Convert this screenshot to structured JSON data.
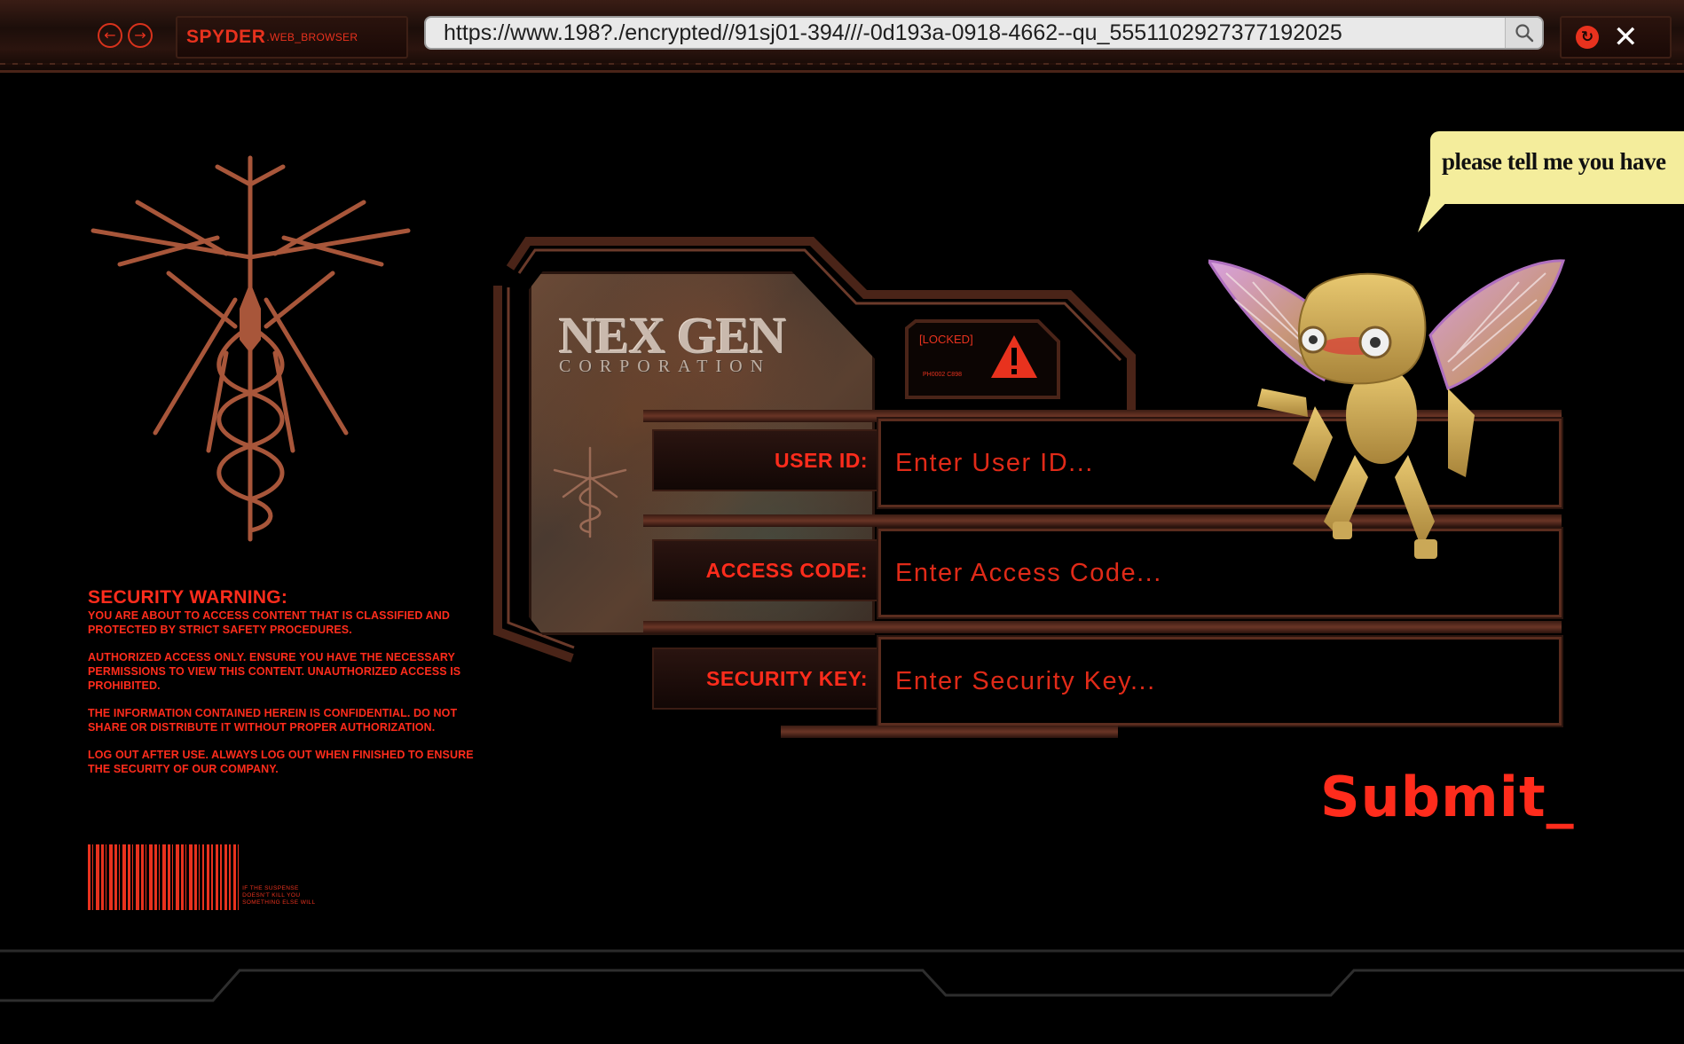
{
  "browser": {
    "name_main": "SPYDER",
    "name_sub": ".WEB_BROWSER",
    "url": "https://www.198?./encrypted//91sj01-394///-0d193a-0918-4662--qu_5551102927377192025",
    "back_icon": "arrow-left-circle-icon",
    "forward_icon": "arrow-right-circle-icon",
    "search_icon": "magnifier-icon",
    "close_glyph": "✕"
  },
  "logo": {
    "name": "NEX GEN",
    "sub": "CORPORATION"
  },
  "status": {
    "locked_label": "[LOCKED]",
    "locked_code": "PH0002 C898"
  },
  "form": {
    "user_id_label": "USER ID:",
    "user_id_placeholder": "Enter User ID...",
    "access_code_label": "ACCESS CODE:",
    "access_code_placeholder": "Enter Access Code...",
    "security_key_label": "SECURITY KEY:",
    "security_key_placeholder": "Enter Security Key...",
    "submit_label": "Submit_"
  },
  "warning": {
    "title": "SECURITY WARNING:",
    "p1": "YOU ARE ABOUT TO ACCESS CONTENT THAT IS CLASSIFIED AND PROTECTED BY STRICT SAFETY PROCEDURES.",
    "p2": "AUTHORIZED ACCESS ONLY. ENSURE YOU HAVE THE NECESSARY PERMISSIONS TO VIEW THIS CONTENT. UNAUTHORIZED ACCESS IS PROHIBITED.",
    "p3": "THE INFORMATION CONTAINED HEREIN IS CONFIDENTIAL. DO NOT SHARE OR DISTRIBUTE IT WITHOUT PROPER AUTHORIZATION.",
    "p4": "LOG OUT AFTER USE. ALWAYS LOG OUT WHEN FINISHED TO ENSURE THE SECURITY OF OUR COMPANY."
  },
  "barcode": {
    "text": "IF THE SUSPENSE DOESN'T KILL YOU SOMETHING ELSE WILL"
  },
  "mascot": {
    "speech": "please tell me you have"
  },
  "colors": {
    "accent": "#e8321e",
    "background": "#000000",
    "bubble": "#f4ed9c"
  }
}
